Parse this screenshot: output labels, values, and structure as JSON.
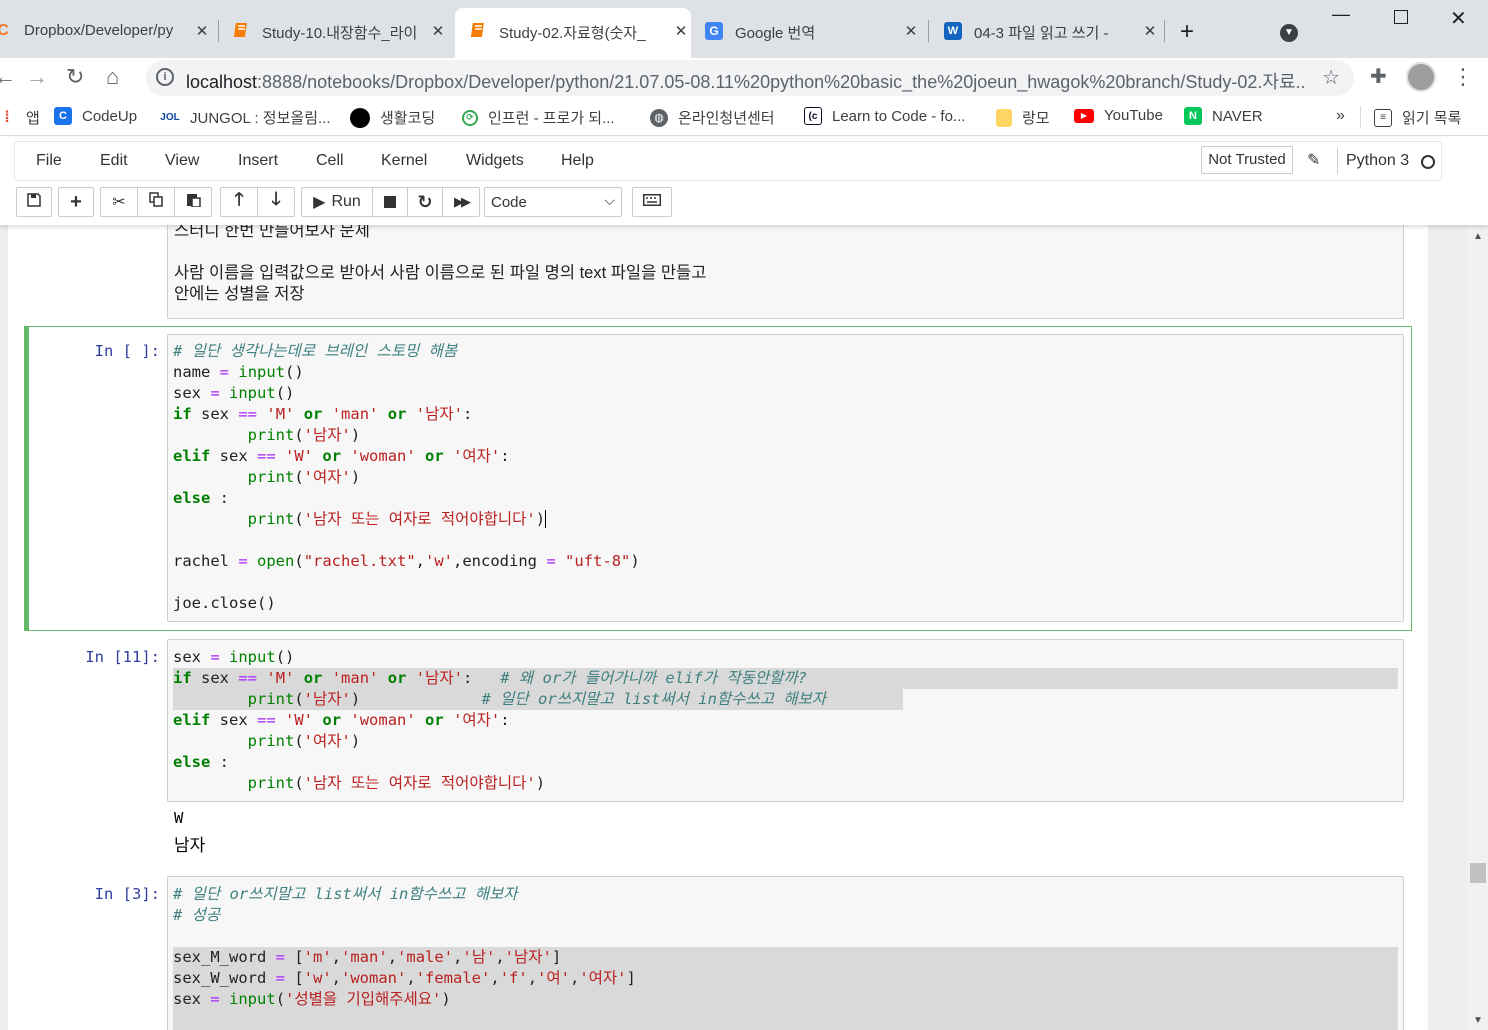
{
  "tabs": [
    {
      "title": "Dropbox/Developer/py",
      "icon": "jupyter-icon"
    },
    {
      "title": "Study-10.내장함수_라이",
      "icon": "notebook-icon"
    },
    {
      "title": "Study-02.자료형(숫자_",
      "icon": "notebook-icon",
      "active": true
    },
    {
      "title": "Google 번역",
      "icon": "google-translate-icon"
    },
    {
      "title": "04-3 파일 읽고 쓰기 -",
      "icon": "wikidocs-icon"
    }
  ],
  "new_tab_label": "+",
  "address": {
    "host": "localhost",
    "path": ":8888/notebooks/Dropbox/Developer/python/21.07.05-08.11%20python%20basic_the%20joeun_hwagok%20branch/Study-02.자료..."
  },
  "bookmarks": [
    {
      "label": "앱",
      "color": "#ea4335"
    },
    {
      "label": "CodeUp",
      "color": "#1a73e8"
    },
    {
      "label": "JUNGOL : 정보올림...",
      "color": "#0d47a1"
    },
    {
      "label": "생활코딩",
      "color": "#000000"
    },
    {
      "label": "인프런 - 프로가 되...",
      "color": "#34a853"
    },
    {
      "label": "온라인청년센터",
      "color": "#3c4043"
    },
    {
      "label": "Learn to Code - fo...",
      "color": "#0a0a23"
    },
    {
      "label": "랑모",
      "color": "#fdd663"
    },
    {
      "label": "YouTube",
      "color": "#ff0000"
    },
    {
      "label": "NAVER",
      "color": "#03c75a"
    }
  ],
  "bookmarks_more": "»",
  "reading_list": "읽기 목록",
  "menu": [
    "File",
    "Edit",
    "View",
    "Insert",
    "Cell",
    "Kernel",
    "Widgets",
    "Help"
  ],
  "trust_label": "Not Trusted",
  "kernel_label": "Python 3",
  "toolbar": {
    "run_label": "Run",
    "cell_type": "Code"
  },
  "markdown_lines": [
    "스터디 한번 만들어보자 문제",
    "",
    "사람 이름을 입력값으로 받아서 사람 이름으로 된 파일 명의 text 파일을 만들고",
    "안에는 성별을 저장"
  ],
  "cells": [
    {
      "prompt": "In [ ]:"
    },
    {
      "prompt": "In [11]:"
    },
    {
      "prompt": "In [3]:"
    }
  ],
  "output_lines": [
    "W",
    "남자"
  ]
}
